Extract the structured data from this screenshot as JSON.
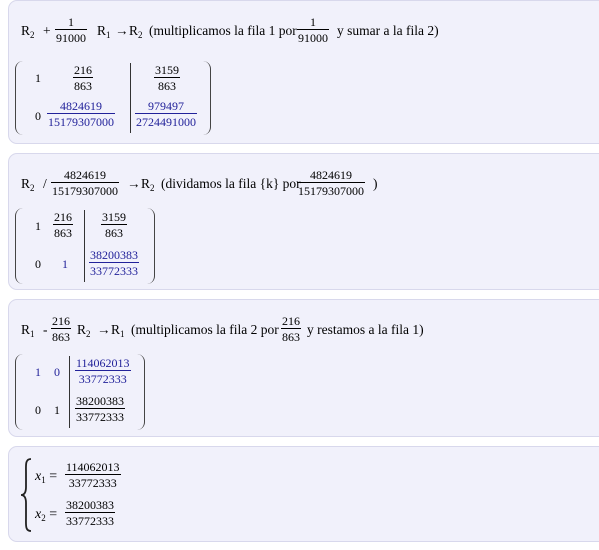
{
  "steps": [
    {
      "pre": "R",
      "pre_sub": "2",
      "op": "+",
      "coef": {
        "num": "1",
        "den": "91000"
      },
      "row": "R",
      "row_sub": "1",
      "arrow": "→",
      "target": "R",
      "target_sub": "2",
      "text": "(multiplicamos la fila 1 por",
      "coef2": {
        "num": "1",
        "den": "91000"
      },
      "text2": "y sumar a la fila 2)",
      "matrix": {
        "r1": {
          "a": "1",
          "b": {
            "num": "216",
            "den": "863"
          },
          "c": {
            "num": "3159",
            "den": "863"
          }
        },
        "r2": {
          "a": "0",
          "b": {
            "num": "4824619",
            "den": "15179307000"
          },
          "c": {
            "num": "979497",
            "den": "2724491000"
          }
        }
      }
    },
    {
      "pre": "R",
      "pre_sub": "2",
      "op": "/",
      "coef": {
        "num": "4824619",
        "den": "15179307000"
      },
      "arrow": "→",
      "target": "R",
      "target_sub": "2",
      "text": "(dividamos la fila {k} por",
      "coef2": {
        "num": "4824619",
        "den": "15179307000"
      },
      "text2": ")",
      "matrix": {
        "r1": {
          "a": "1",
          "b": {
            "num": "216",
            "den": "863"
          },
          "c": {
            "num": "3159",
            "den": "863"
          }
        },
        "r2": {
          "a": "0",
          "b": "1",
          "c": {
            "num": "38200383",
            "den": "33772333"
          }
        }
      }
    },
    {
      "pre": "R",
      "pre_sub": "1",
      "op": "-",
      "coef": {
        "num": "216",
        "den": "863"
      },
      "row": "R",
      "row_sub": "2",
      "arrow": "→",
      "target": "R",
      "target_sub": "1",
      "text": "(multiplicamos la fila 2 por",
      "coef2": {
        "num": "216",
        "den": "863"
      },
      "text2": "y restamos a la fila 1)",
      "matrix": {
        "r1": {
          "a": "1",
          "b": "0",
          "c": {
            "num": "114062013",
            "den": "33772333"
          }
        },
        "r2": {
          "a": "0",
          "b": "1",
          "c": {
            "num": "38200383",
            "den": "33772333"
          }
        }
      }
    }
  ],
  "solution": {
    "x1": {
      "var": "x",
      "sub": "1",
      "eq": "=",
      "num": "114062013",
      "den": "33772333"
    },
    "x2": {
      "var": "x",
      "sub": "2",
      "eq": "=",
      "num": "38200383",
      "den": "33772333"
    }
  }
}
